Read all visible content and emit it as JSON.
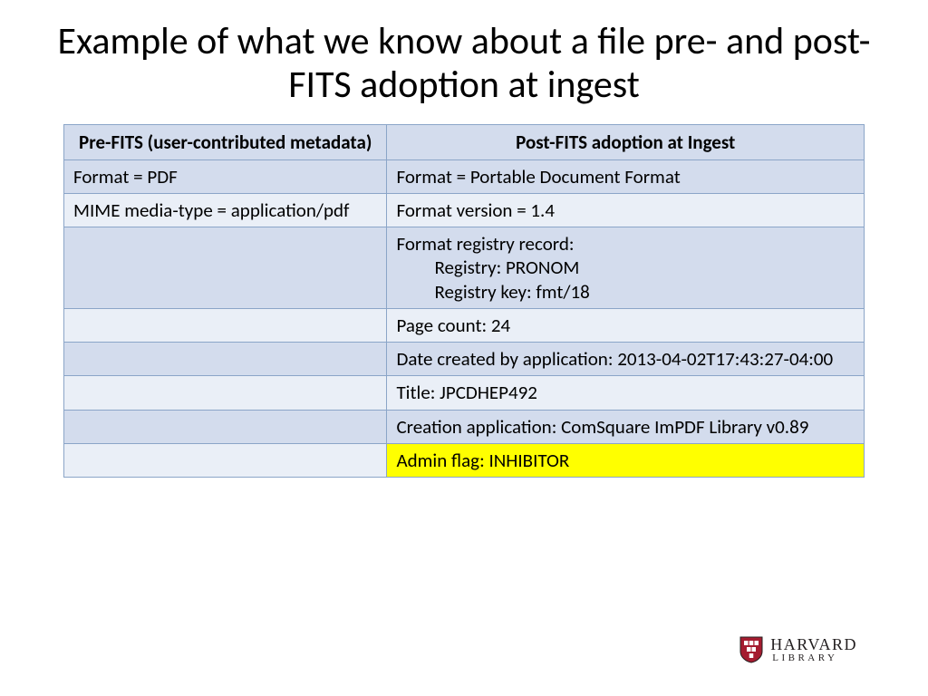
{
  "title": "Example of what we know about a file pre- and post-FITS adoption at ingest",
  "table": {
    "headers": [
      "Pre-FITS (user-contributed metadata)",
      "Post-FITS adoption at Ingest"
    ],
    "rows": [
      {
        "left": "Format = PDF",
        "right": "Format = Portable Document Format",
        "shade": "a"
      },
      {
        "left": "MIME media-type = application/pdf",
        "right": "Format version = 1.4",
        "shade": "b"
      },
      {
        "left": "",
        "right_main": "Format registry record:",
        "right_sub": [
          "Registry: PRONOM",
          "Registry key: fmt/18"
        ],
        "shade": "a"
      },
      {
        "left": "",
        "right": "Page count: 24",
        "shade": "b"
      },
      {
        "left": "",
        "right": "Date created by application: 2013-04-02T17:43:27-04:00",
        "shade": "a"
      },
      {
        "left": "",
        "right": "Title: JPCDHEP492",
        "shade": "b"
      },
      {
        "left": "",
        "right": "Creation application: ComSquare ImPDF Library v0.89",
        "shade": "a"
      },
      {
        "left": "",
        "right": "Admin flag: INHIBITOR",
        "shade": "b",
        "highlight": true
      }
    ]
  },
  "logo": {
    "top": "HARVARD",
    "bottom": "LIBRARY"
  }
}
